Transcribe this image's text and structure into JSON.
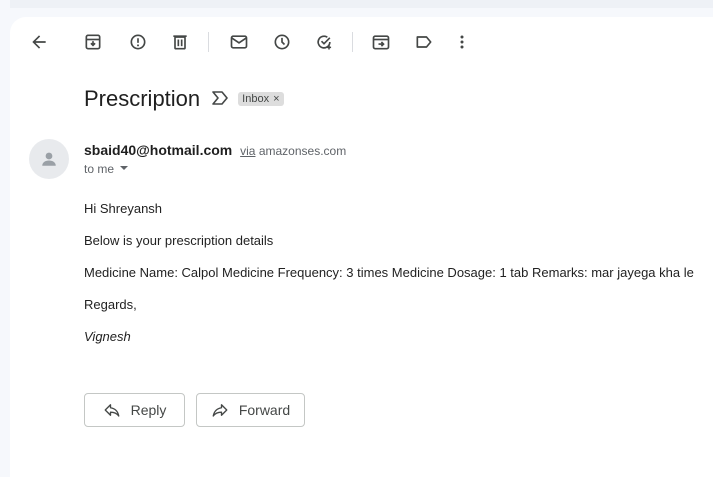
{
  "email": {
    "subject": "Prescription",
    "label": "Inbox",
    "label_close": "×",
    "sender_email": "sbaid40@hotmail.com",
    "via_text": "via",
    "via_domain": "amazonses.com",
    "to_text": "to me",
    "body_lines": [
      "Hi Shreyansh",
      "Below is your prescription details",
      "Medicine Name: Calpol Medicine Frequency: 3 times Medicine Dosage: 1 tab Remarks: mar jayega kha le",
      "Regards,",
      "Vignesh"
    ]
  },
  "actions": {
    "reply_label": "Reply",
    "forward_label": "Forward"
  },
  "toolbar_icons": [
    "back-icon",
    "archive-icon",
    "report-spam-icon",
    "delete-icon",
    "mark-unread-icon",
    "snooze-icon",
    "add-task-icon",
    "move-to-icon",
    "labels-icon",
    "more-icon"
  ]
}
